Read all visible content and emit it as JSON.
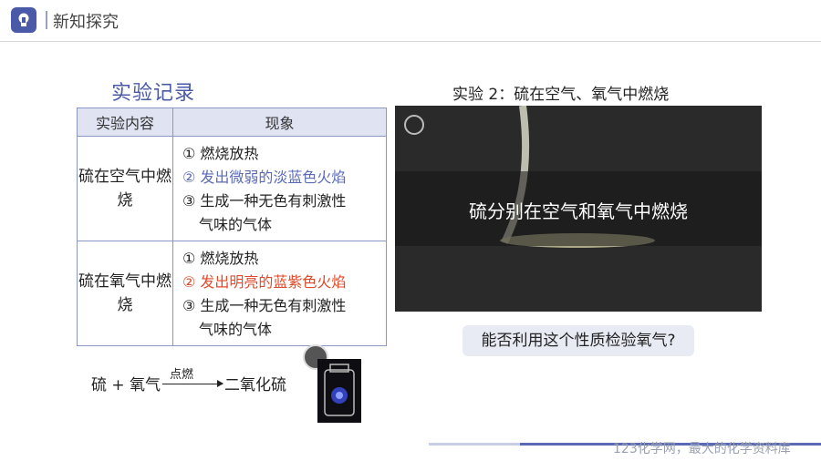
{
  "header": {
    "title": "新知探究",
    "icon": "lightbulb-icon"
  },
  "record": {
    "title": "实验记录",
    "col_content": "实验内容",
    "col_phenomenon": "现象",
    "rows": [
      {
        "content": "硫在空气中燃烧",
        "phenomena": [
          "① 燃烧放热",
          "② 发出微弱的淡蓝色火焰",
          "③ 生成一种无色有刺激性",
          "气味的气体"
        ]
      },
      {
        "content": "硫在氧气中燃烧",
        "phenomena": [
          "① 燃烧放热",
          "② 发出明亮的蓝紫色火焰",
          "③ 生成一种无色有刺激性",
          "气味的气体"
        ]
      }
    ]
  },
  "equation": {
    "reactants": "硫 + 氧气",
    "condition": "点燃",
    "product": "二氧化硫"
  },
  "experiment": {
    "title": "实验 2：硫在空气、氧气中燃烧",
    "video_caption": "硫分别在空气和氧气中燃烧"
  },
  "question": "能否利用这个性质检验氧气?",
  "watermark": "123化学网，最大的化学资料库",
  "colors": {
    "accent": "#4a5aa8",
    "blue_text": "#5b6bb5",
    "red_text": "#e04a2a"
  }
}
